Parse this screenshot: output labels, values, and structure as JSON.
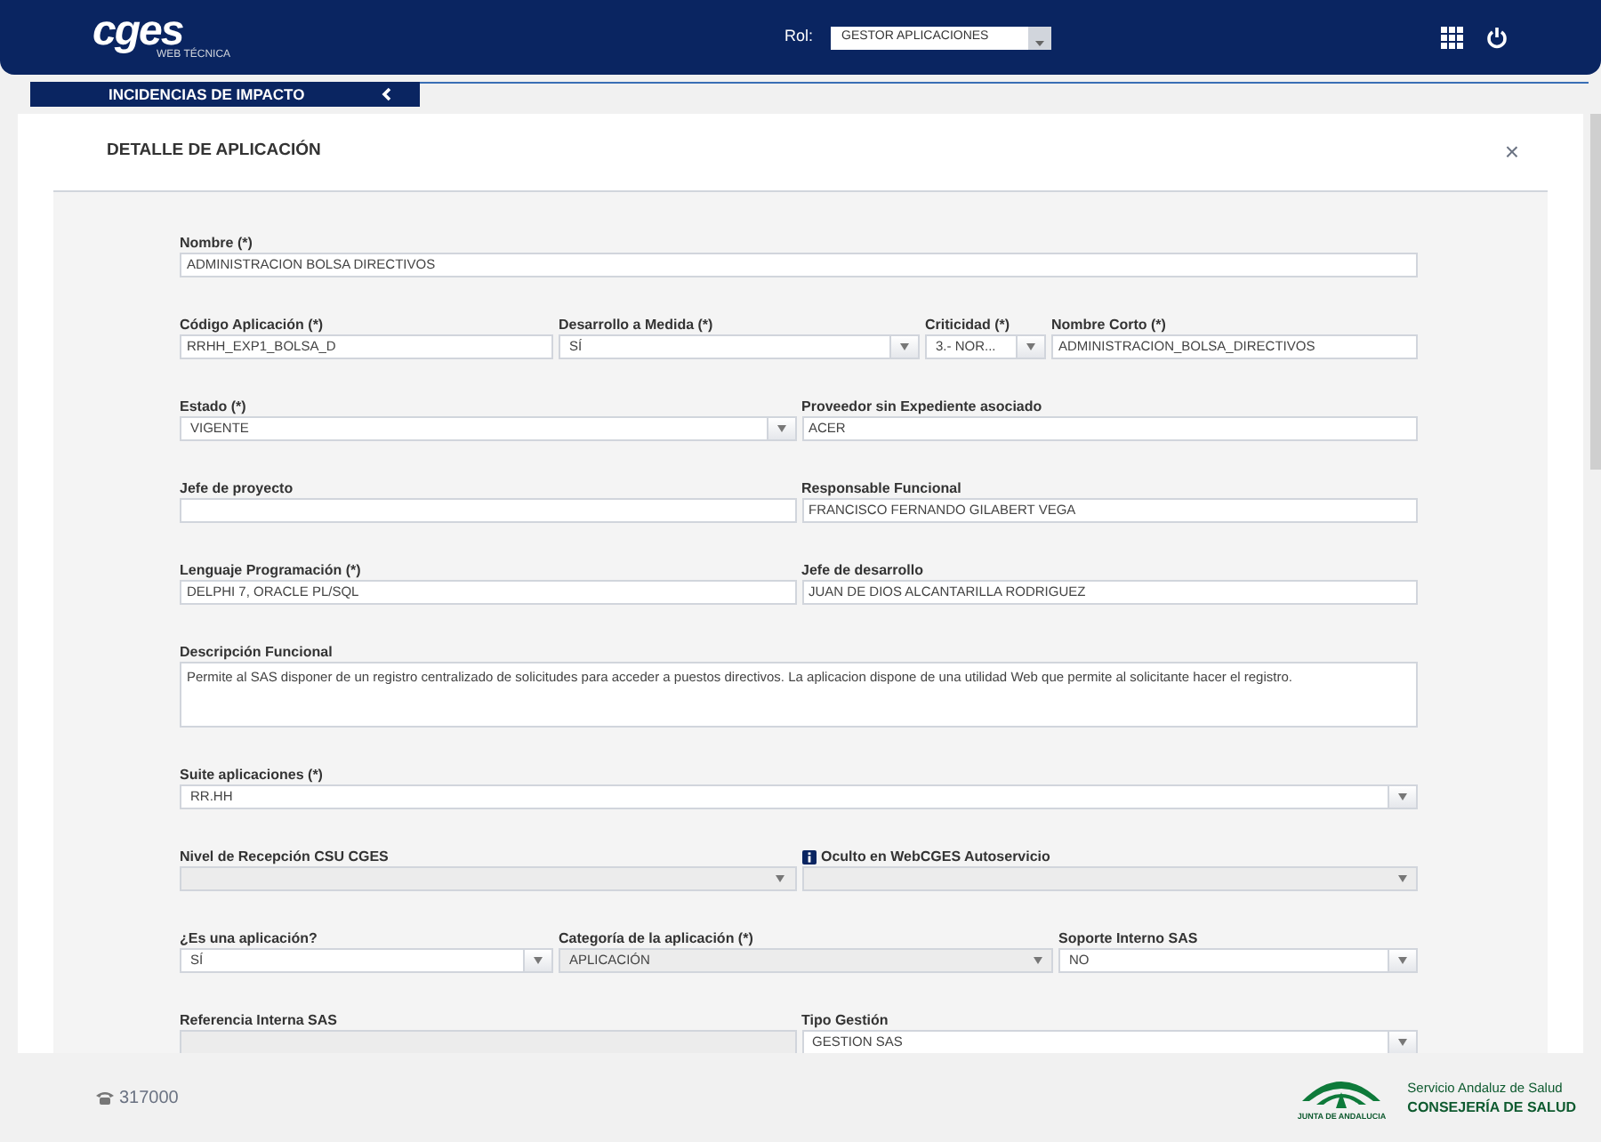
{
  "header": {
    "logo": "cges",
    "logo_subtitle": "WEB TÉCNICA",
    "role_label": "Rol:",
    "role_value": "GESTOR APLICACIONES"
  },
  "tab": {
    "label": "INCIDENCIAS DE IMPACTO"
  },
  "dialog": {
    "title": "DETALLE DE APLICACIÓN",
    "close": "×"
  },
  "rows": [
    {
      "kind": "single",
      "fields": [
        {
          "label": "Nombre (*)",
          "kind": "text",
          "value": "ADMINISTRACION BOLSA DIRECTIVOS",
          "disabled": false
        }
      ]
    },
    {
      "kind": "quad",
      "fields": [
        {
          "label": "Código Aplicación (*)",
          "kind": "text",
          "value": "RRHH_EXP1_BOLSA_D",
          "disabled": false
        },
        {
          "label": "Desarrollo a Medida (*)",
          "kind": "select",
          "value": "SÍ",
          "disabled": false
        },
        {
          "label": "Criticidad (*)",
          "kind": "select",
          "value": "3.- NOR...",
          "disabled": false
        },
        {
          "label": "Nombre Corto (*)",
          "kind": "text",
          "value": "ADMINISTRACION_BOLSA_DIRECTIVOS",
          "disabled": false
        }
      ]
    },
    {
      "kind": "pair",
      "fields": [
        {
          "label": "Estado (*)",
          "kind": "select",
          "value": "VIGENTE",
          "disabled": false
        },
        {
          "label": "Proveedor sin Expediente asociado",
          "kind": "text",
          "value": "ACER",
          "disabled": false
        }
      ]
    },
    {
      "kind": "pair",
      "fields": [
        {
          "label": "Jefe de proyecto",
          "kind": "text",
          "disabled": false
        },
        {
          "label": "Responsable Funcional",
          "kind": "text",
          "value": "FRANCISCO FERNANDO GILABERT VEGA",
          "disabled": false
        }
      ]
    },
    {
      "kind": "pair",
      "fields": [
        {
          "label": "Lenguaje Programación (*)",
          "kind": "text",
          "value": "DELPHI 7, ORACLE PL/SQL",
          "disabled": false
        },
        {
          "label": "Jefe de desarrollo",
          "kind": "text",
          "value": "JUAN DE DIOS ALCANTARILLA RODRIGUEZ",
          "disabled": false
        }
      ]
    },
    {
      "kind": "single",
      "fields": [
        {
          "label": "Descripción Funcional",
          "kind": "textarea",
          "value": "Permite al SAS disponer de un registro centralizado de solicitudes para acceder a puestos directivos. La aplicacion dispone de una utilidad Web que permite al solicitante hacer el registro.",
          "disabled": false
        }
      ]
    },
    {
      "kind": "single",
      "fields": [
        {
          "label": "Suite aplicaciones (*)",
          "kind": "select",
          "value": "RR.HH",
          "disabled": false
        }
      ]
    },
    {
      "kind": "pair",
      "fields": [
        {
          "label": "Nivel de Recepción CSU CGES",
          "kind": "select",
          "disabled": true
        },
        {
          "label": "Oculto en WebCGES Autoservicio",
          "kind": "select",
          "disabled": true,
          "info": true
        }
      ]
    },
    {
      "kind": "triple",
      "fields": [
        {
          "label": "¿Es una aplicación?",
          "kind": "select",
          "value": "SÍ",
          "disabled": false
        },
        {
          "label": "Categoría de la aplicación (*)",
          "kind": "select",
          "value": "APLICACIÓN",
          "disabled": true
        },
        {
          "label": "Soporte Interno SAS",
          "kind": "select",
          "value": "NO",
          "disabled": false
        }
      ]
    },
    {
      "kind": "pair",
      "fields": [
        {
          "label": "Referencia Interna SAS",
          "kind": "text",
          "disabled": true
        },
        {
          "label": "Tipo Gestión",
          "kind": "select",
          "value": "GESTION SAS",
          "disabled": false
        }
      ]
    }
  ],
  "footer": {
    "phone": "317000",
    "junta": "JUNTA DE ANDALUCIA",
    "service": "Servicio Andaluz de Salud",
    "ministry": "CONSEJERÍA DE SALUD"
  }
}
